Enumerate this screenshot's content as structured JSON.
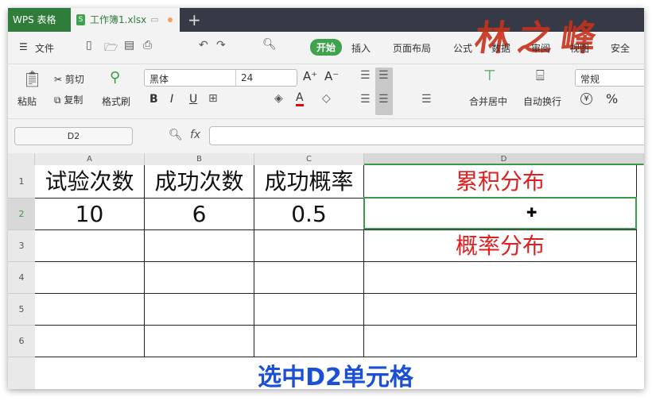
{
  "tabs": {
    "app": "WPS 表格",
    "doc": "工作簿1.xlsx",
    "doc_icon": "S",
    "new_tab": "+"
  },
  "logo": "林之峰",
  "menu": {
    "file": "文件",
    "items": [
      "开始",
      "插入",
      "页面布局",
      "公式",
      "数据",
      "审阅",
      "视图",
      "安全"
    ]
  },
  "ribbon": {
    "paste": "粘贴",
    "cut": "剪切",
    "copy": "复制",
    "format_painter": "格式刷",
    "font": "黑体",
    "size": "24",
    "merge": "合并居中",
    "wrap": "自动换行",
    "number_format": "常规",
    "percent": "%",
    "currency": "¥",
    "bold": "B",
    "italic": "I",
    "underline": "U",
    "grow": "A⁺",
    "shrink": "A⁻"
  },
  "formula": {
    "name_box": "D2",
    "fx": "fx",
    "value": ""
  },
  "columns": [
    "A",
    "B",
    "C",
    "D"
  ],
  "rows": [
    "1",
    "2",
    "3",
    "4",
    "5",
    "6"
  ],
  "cells": {
    "A1": "试验次数",
    "B1": "成功次数",
    "C1": "成功概率",
    "D1": "累积分布",
    "A2": "10",
    "B2": "6",
    "C2": "0.5",
    "D2": "",
    "D3": "概率分布"
  },
  "caption": "选中D2单元格"
}
